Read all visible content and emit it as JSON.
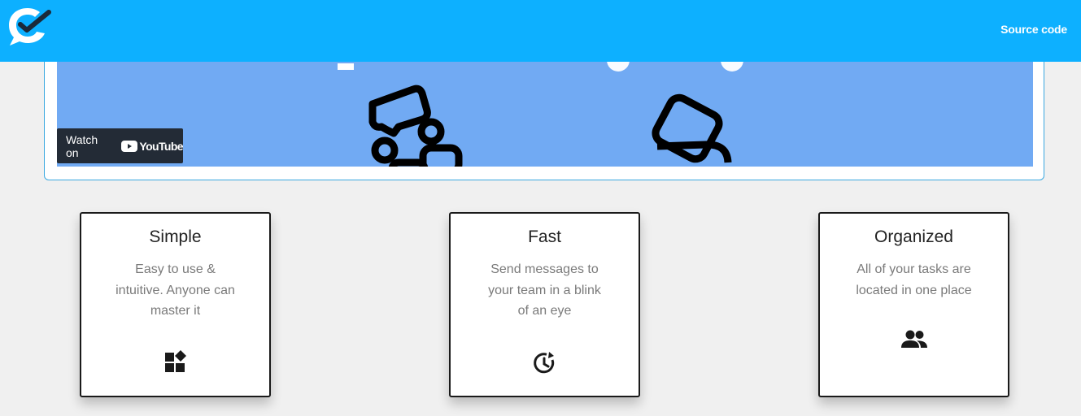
{
  "header": {
    "brand_color": "#0db0ff",
    "logo_icon": "chat-check-logo-icon",
    "source_link_label": "Source code"
  },
  "video": {
    "background_color": "#71aaf3",
    "watch_label": "Watch on",
    "platform_label": "YouTube"
  },
  "features": [
    {
      "title": "Simple",
      "description": "Easy to use & intuitive. Anyone can master it",
      "icon": "widgets-icon"
    },
    {
      "title": "Fast",
      "description": "Send messages to your team in a blink of an eye",
      "icon": "clock-refresh-icon"
    },
    {
      "title": "Organized",
      "description": "All of your tasks are located in one place",
      "icon": "people-icon"
    }
  ]
}
